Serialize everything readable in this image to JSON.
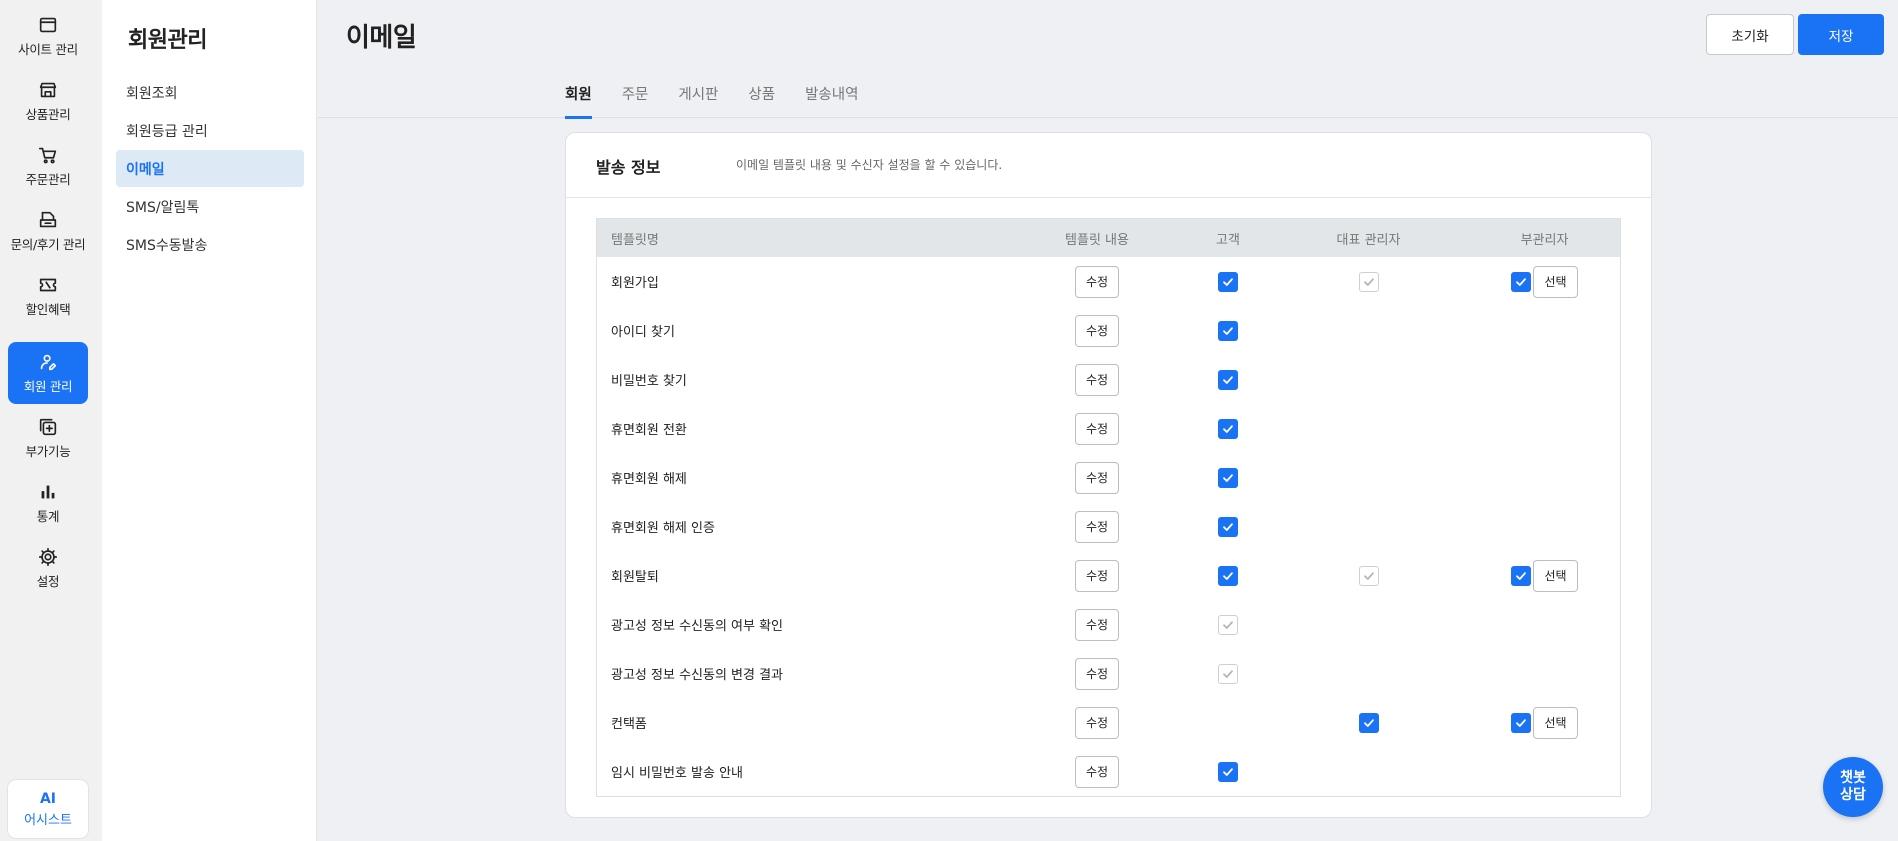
{
  "rail": {
    "items": [
      {
        "label": "사이트 관리",
        "icon": "window-icon"
      },
      {
        "label": "상품관리",
        "icon": "store-icon"
      },
      {
        "label": "주문관리",
        "icon": "cart-icon"
      },
      {
        "label": "문의/후기 관리",
        "icon": "inbox-icon"
      },
      {
        "label": "할인혜택",
        "icon": "ticket-icon"
      },
      {
        "label": "회원 관리",
        "icon": "member-icon",
        "active": true
      },
      {
        "label": "부가기능",
        "icon": "addon-icon"
      },
      {
        "label": "통계",
        "icon": "bar-chart-icon"
      },
      {
        "label": "설정",
        "icon": "gear-icon"
      }
    ],
    "assistant": {
      "badge": "AI",
      "label": "어시스트"
    }
  },
  "subnav": {
    "title": "회원관리",
    "items": [
      {
        "label": "회원조회"
      },
      {
        "label": "회원등급 관리"
      },
      {
        "label": "이메일",
        "active": true
      },
      {
        "label": "SMS/알림톡"
      },
      {
        "label": "SMS수동발송"
      }
    ]
  },
  "header": {
    "title": "이메일",
    "reset_label": "초기화",
    "save_label": "저장"
  },
  "tabs": [
    {
      "label": "회원",
      "active": true
    },
    {
      "label": "주문"
    },
    {
      "label": "게시판"
    },
    {
      "label": "상품"
    },
    {
      "label": "발송내역"
    }
  ],
  "card": {
    "title": "발송 정보",
    "description": "이메일 템플릿 내용 및 수신자 설정을 할 수 있습니다."
  },
  "table": {
    "columns": [
      "템플릿명",
      "템플릿 내용",
      "고객",
      "대표 관리자",
      "부관리자"
    ],
    "edit_label": "수정",
    "select_label": "선택",
    "rows": [
      {
        "name": "회원가입",
        "customer": "on",
        "rep": "disabled",
        "sub": "on"
      },
      {
        "name": "아이디 찾기",
        "customer": "on",
        "rep": "none",
        "sub": "none"
      },
      {
        "name": "비밀번호 찾기",
        "customer": "on",
        "rep": "none",
        "sub": "none"
      },
      {
        "name": "휴면회원 전환",
        "customer": "on",
        "rep": "none",
        "sub": "none"
      },
      {
        "name": "휴면회원 해제",
        "customer": "on",
        "rep": "none",
        "sub": "none"
      },
      {
        "name": "휴면회원 해제 인증",
        "customer": "on",
        "rep": "none",
        "sub": "none"
      },
      {
        "name": "회원탈퇴",
        "customer": "on",
        "rep": "disabled",
        "sub": "on"
      },
      {
        "name": "광고성 정보 수신동의 여부 확인",
        "customer": "disabled",
        "rep": "none",
        "sub": "none"
      },
      {
        "name": "광고성 정보 수신동의 변경 결과",
        "customer": "disabled",
        "rep": "none",
        "sub": "none"
      },
      {
        "name": "컨택폼",
        "customer": "none",
        "rep": "on",
        "sub": "on"
      },
      {
        "name": "임시 비밀번호 발송 안내",
        "customer": "on",
        "rep": "none",
        "sub": "none"
      }
    ]
  },
  "chatbot": {
    "label_line1": "챗봇",
    "label_line2": "상담"
  },
  "colors": {
    "accent": "#1a73f5",
    "active_subnav_bg": "#dde9f5"
  }
}
